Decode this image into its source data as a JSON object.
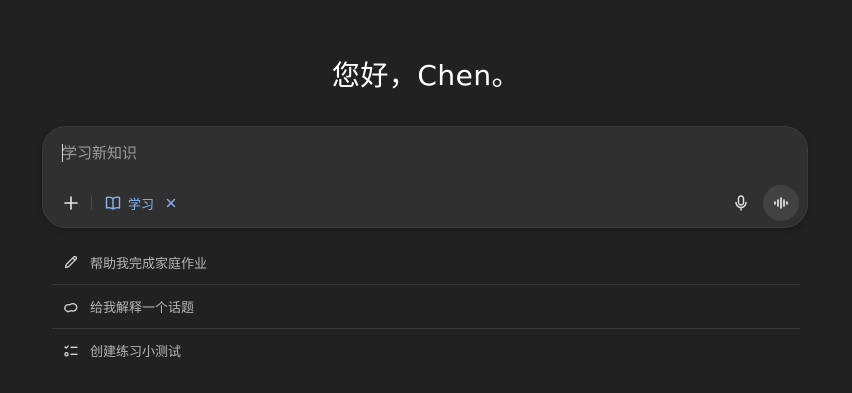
{
  "greeting": "您好，Chen。",
  "composer": {
    "placeholder": "学习新知识",
    "add_icon": "plus-icon",
    "tool_chip": {
      "label": "学习",
      "icon": "book-open-icon",
      "close_icon": "close-icon",
      "color": "#8ab4f8"
    },
    "mic_icon": "microphone-icon",
    "voice_icon": "voice-waveform-icon"
  },
  "suggestions": [
    {
      "label": "帮助我完成家庭作业",
      "icon": "pencil-icon"
    },
    {
      "label": "给我解释一个话题",
      "icon": "chat-bubbles-icon"
    },
    {
      "label": "创建练习小测试",
      "icon": "checklist-icon"
    }
  ],
  "colors": {
    "background": "#212121",
    "composer": "#303030",
    "accent": "#8ab4f8"
  }
}
